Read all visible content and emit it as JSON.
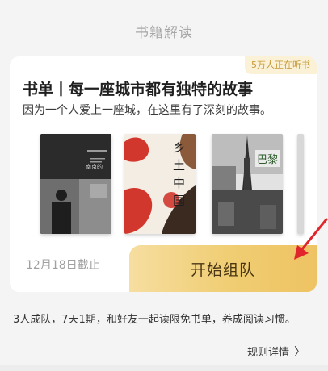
{
  "section_title": "书籍解读",
  "card": {
    "badge": "5万人正在听书",
    "title": "书单丨每一座城市都有独特的故事",
    "subtitle": "因为一个人爱上一座城，在这里有了深刻的故事。",
    "books": [
      {
        "cover_text": "南京的",
        "theme": "dark"
      },
      {
        "cover_text": "乡土中国",
        "theme": "cream"
      },
      {
        "cover_text": "巴黎",
        "theme": "photo"
      },
      {
        "cover_text": "",
        "theme": "partial"
      }
    ],
    "deadline": "12月18日截止",
    "start_button": "开始组队"
  },
  "description": "3人成队，7天1期，和好友一起读限免书单，养成阅读习惯。",
  "rules_link": "规则详情",
  "colors": {
    "background": "#f4f4f4",
    "button_gold": "#f0cd72",
    "badge_bg": "#fbf1d6",
    "arrow_red": "#e0262c"
  }
}
